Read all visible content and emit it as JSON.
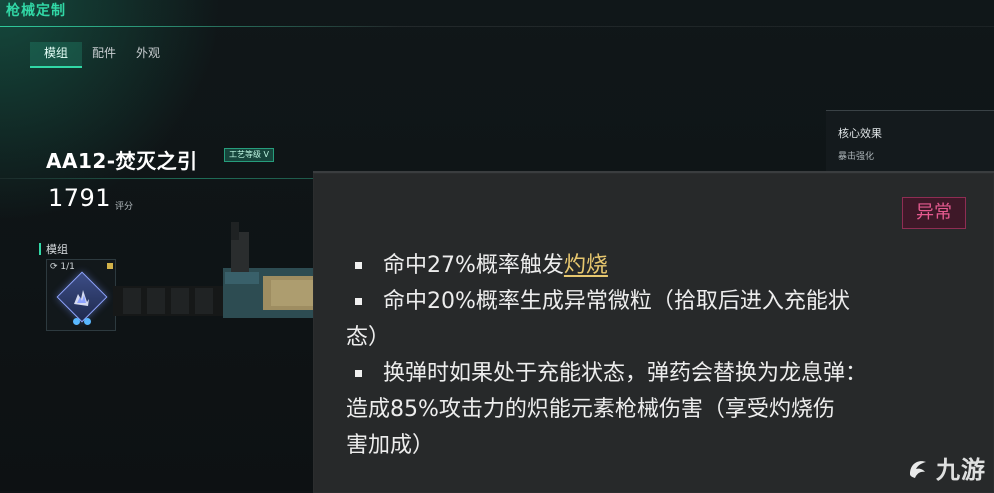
{
  "page": {
    "title": "枪械定制"
  },
  "tabs": [
    {
      "label": "模组",
      "active": true
    },
    {
      "label": "配件",
      "active": false
    },
    {
      "label": "外观",
      "active": false
    }
  ],
  "core_effects": {
    "title": "核心效果",
    "item": "暴击强化"
  },
  "weapon": {
    "name": "AA12-焚灭之引",
    "craft_badge": "工艺等级 V",
    "score": "1791",
    "score_label": "评分"
  },
  "mods": {
    "label": "模组",
    "count": "1/1"
  },
  "effect_panel": {
    "tag": "异常",
    "items": [
      {
        "prefix": "命中27%概率触发",
        "link": "灼烧"
      },
      {
        "line1": "命中20%概率生成异常微粒（拾取后进入充能状",
        "line2": "态）"
      },
      {
        "line1": "换弹时如果处于充能状态，弹药会替换为龙息弹：",
        "line2": "造成85%攻击力的炽能元素枪械伤害（享受灼烧伤",
        "line3": "害加成）"
      }
    ]
  },
  "watermark": {
    "text": "九游"
  },
  "colors": {
    "accent": "#31d8a6",
    "anomaly": "#e45a8f",
    "burn_highlight": "#e7c76f",
    "panel_bg": "#27292a"
  }
}
